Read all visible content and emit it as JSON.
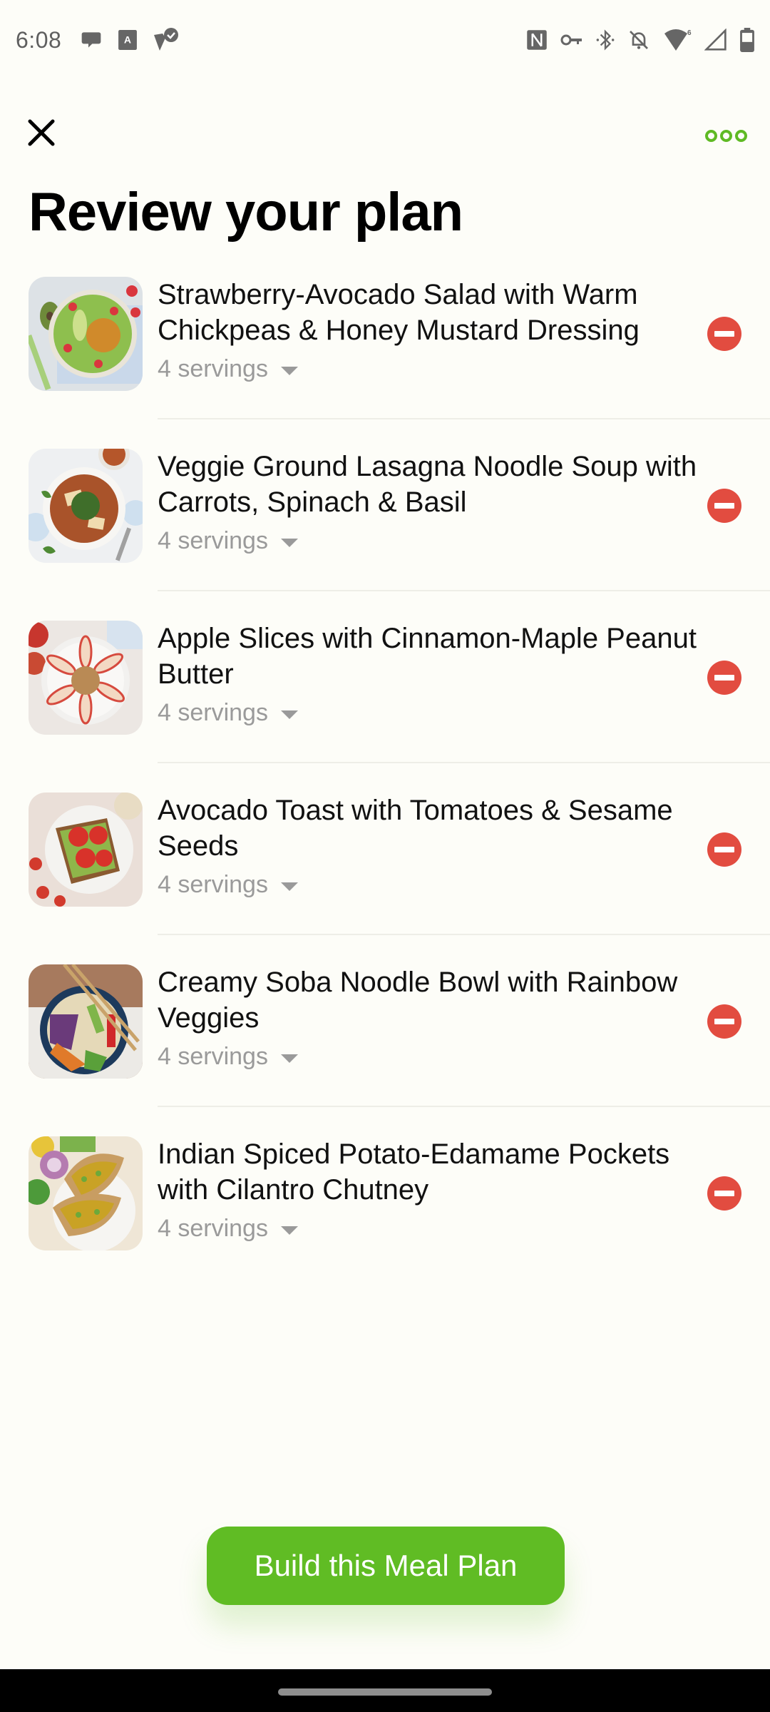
{
  "status_bar": {
    "time": "6:08",
    "left_icons": [
      "chat-bubble-icon",
      "accessibility-text-icon",
      "verified-check-icon"
    ],
    "right_icons": [
      "nfc-icon",
      "vpn-key-icon",
      "bluetooth-icon",
      "notifications-off-icon",
      "wifi-6-icon",
      "cell-signal-icon",
      "battery-icon"
    ],
    "wifi_label": "6"
  },
  "app_bar": {
    "close_icon": "close-icon",
    "more_icon": "more-options-icon"
  },
  "page": {
    "title": "Review your plan"
  },
  "recipes": [
    {
      "title": "Strawberry-Avocado Salad with Warm Chickpeas & Honey Mustard Dressing",
      "servings": "4 servings",
      "image": "salad-bowl"
    },
    {
      "title": "Veggie Ground Lasagna Noodle Soup with Carrots, Spinach & Basil",
      "servings": "4 servings",
      "image": "soup-bowl"
    },
    {
      "title": "Apple Slices with Cinnamon-Maple Peanut Butter",
      "servings": "4 servings",
      "image": "apple-plate"
    },
    {
      "title": "Avocado Toast with Tomatoes & Sesame Seeds",
      "servings": "4 servings",
      "image": "toast-plate"
    },
    {
      "title": "Creamy Soba Noodle Bowl with Rainbow Veggies",
      "servings": "4 servings",
      "image": "soba-bowl"
    },
    {
      "title": "Indian Spiced Potato-Edamame Pockets with Cilantro Chutney",
      "servings": "4 servings",
      "image": "pita-pockets"
    }
  ],
  "cta": {
    "label": "Build this Meal Plan"
  },
  "colors": {
    "accent": "#60bc24",
    "remove": "#e24c40",
    "background": "#fdfdf8",
    "muted_text": "#9a9a9a"
  }
}
